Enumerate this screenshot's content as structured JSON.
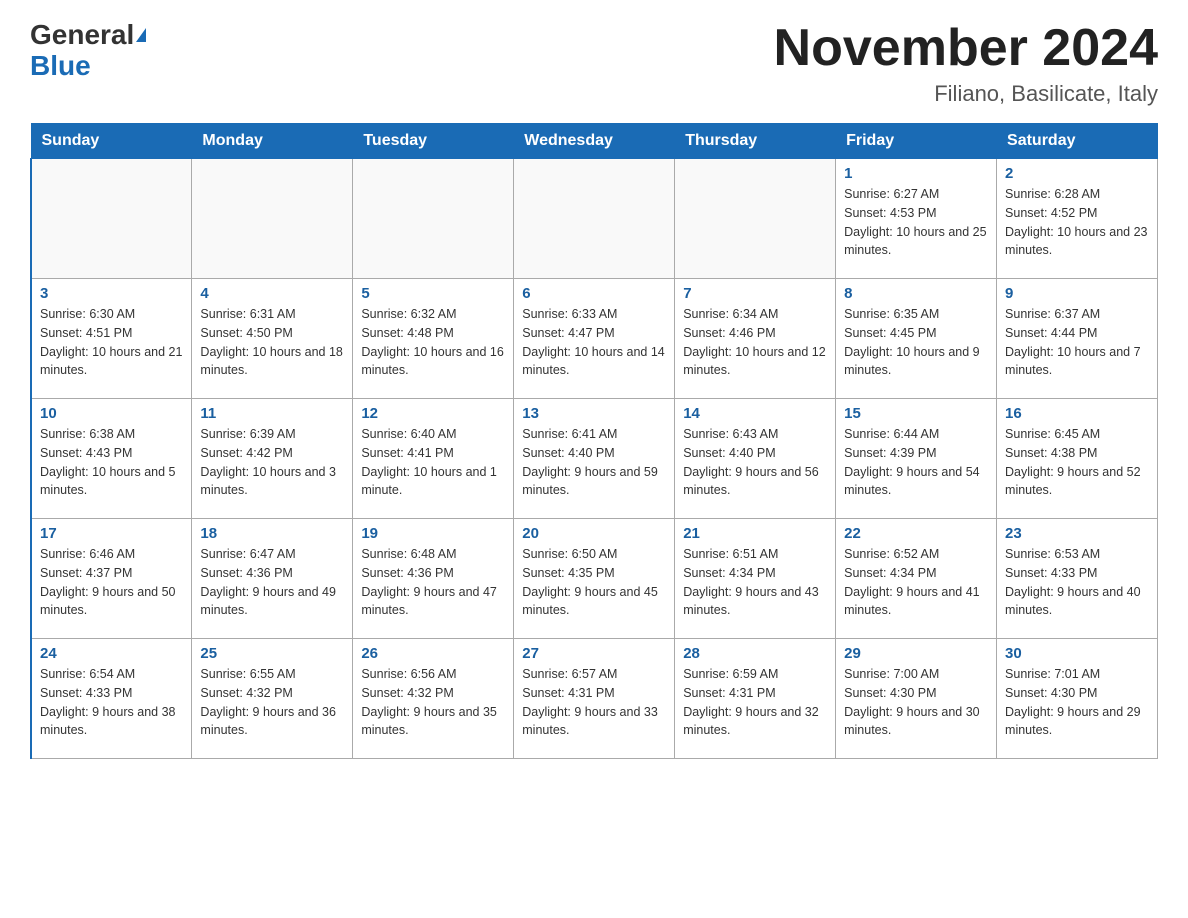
{
  "header": {
    "logo_general": "General",
    "logo_blue": "Blue",
    "month_title": "November 2024",
    "location": "Filiano, Basilicate, Italy"
  },
  "days_of_week": [
    "Sunday",
    "Monday",
    "Tuesday",
    "Wednesday",
    "Thursday",
    "Friday",
    "Saturday"
  ],
  "weeks": [
    [
      {
        "day": "",
        "info": ""
      },
      {
        "day": "",
        "info": ""
      },
      {
        "day": "",
        "info": ""
      },
      {
        "day": "",
        "info": ""
      },
      {
        "day": "",
        "info": ""
      },
      {
        "day": "1",
        "info": "Sunrise: 6:27 AM\nSunset: 4:53 PM\nDaylight: 10 hours and 25 minutes."
      },
      {
        "day": "2",
        "info": "Sunrise: 6:28 AM\nSunset: 4:52 PM\nDaylight: 10 hours and 23 minutes."
      }
    ],
    [
      {
        "day": "3",
        "info": "Sunrise: 6:30 AM\nSunset: 4:51 PM\nDaylight: 10 hours and 21 minutes."
      },
      {
        "day": "4",
        "info": "Sunrise: 6:31 AM\nSunset: 4:50 PM\nDaylight: 10 hours and 18 minutes."
      },
      {
        "day": "5",
        "info": "Sunrise: 6:32 AM\nSunset: 4:48 PM\nDaylight: 10 hours and 16 minutes."
      },
      {
        "day": "6",
        "info": "Sunrise: 6:33 AM\nSunset: 4:47 PM\nDaylight: 10 hours and 14 minutes."
      },
      {
        "day": "7",
        "info": "Sunrise: 6:34 AM\nSunset: 4:46 PM\nDaylight: 10 hours and 12 minutes."
      },
      {
        "day": "8",
        "info": "Sunrise: 6:35 AM\nSunset: 4:45 PM\nDaylight: 10 hours and 9 minutes."
      },
      {
        "day": "9",
        "info": "Sunrise: 6:37 AM\nSunset: 4:44 PM\nDaylight: 10 hours and 7 minutes."
      }
    ],
    [
      {
        "day": "10",
        "info": "Sunrise: 6:38 AM\nSunset: 4:43 PM\nDaylight: 10 hours and 5 minutes."
      },
      {
        "day": "11",
        "info": "Sunrise: 6:39 AM\nSunset: 4:42 PM\nDaylight: 10 hours and 3 minutes."
      },
      {
        "day": "12",
        "info": "Sunrise: 6:40 AM\nSunset: 4:41 PM\nDaylight: 10 hours and 1 minute."
      },
      {
        "day": "13",
        "info": "Sunrise: 6:41 AM\nSunset: 4:40 PM\nDaylight: 9 hours and 59 minutes."
      },
      {
        "day": "14",
        "info": "Sunrise: 6:43 AM\nSunset: 4:40 PM\nDaylight: 9 hours and 56 minutes."
      },
      {
        "day": "15",
        "info": "Sunrise: 6:44 AM\nSunset: 4:39 PM\nDaylight: 9 hours and 54 minutes."
      },
      {
        "day": "16",
        "info": "Sunrise: 6:45 AM\nSunset: 4:38 PM\nDaylight: 9 hours and 52 minutes."
      }
    ],
    [
      {
        "day": "17",
        "info": "Sunrise: 6:46 AM\nSunset: 4:37 PM\nDaylight: 9 hours and 50 minutes."
      },
      {
        "day": "18",
        "info": "Sunrise: 6:47 AM\nSunset: 4:36 PM\nDaylight: 9 hours and 49 minutes."
      },
      {
        "day": "19",
        "info": "Sunrise: 6:48 AM\nSunset: 4:36 PM\nDaylight: 9 hours and 47 minutes."
      },
      {
        "day": "20",
        "info": "Sunrise: 6:50 AM\nSunset: 4:35 PM\nDaylight: 9 hours and 45 minutes."
      },
      {
        "day": "21",
        "info": "Sunrise: 6:51 AM\nSunset: 4:34 PM\nDaylight: 9 hours and 43 minutes."
      },
      {
        "day": "22",
        "info": "Sunrise: 6:52 AM\nSunset: 4:34 PM\nDaylight: 9 hours and 41 minutes."
      },
      {
        "day": "23",
        "info": "Sunrise: 6:53 AM\nSunset: 4:33 PM\nDaylight: 9 hours and 40 minutes."
      }
    ],
    [
      {
        "day": "24",
        "info": "Sunrise: 6:54 AM\nSunset: 4:33 PM\nDaylight: 9 hours and 38 minutes."
      },
      {
        "day": "25",
        "info": "Sunrise: 6:55 AM\nSunset: 4:32 PM\nDaylight: 9 hours and 36 minutes."
      },
      {
        "day": "26",
        "info": "Sunrise: 6:56 AM\nSunset: 4:32 PM\nDaylight: 9 hours and 35 minutes."
      },
      {
        "day": "27",
        "info": "Sunrise: 6:57 AM\nSunset: 4:31 PM\nDaylight: 9 hours and 33 minutes."
      },
      {
        "day": "28",
        "info": "Sunrise: 6:59 AM\nSunset: 4:31 PM\nDaylight: 9 hours and 32 minutes."
      },
      {
        "day": "29",
        "info": "Sunrise: 7:00 AM\nSunset: 4:30 PM\nDaylight: 9 hours and 30 minutes."
      },
      {
        "day": "30",
        "info": "Sunrise: 7:01 AM\nSunset: 4:30 PM\nDaylight: 9 hours and 29 minutes."
      }
    ]
  ]
}
